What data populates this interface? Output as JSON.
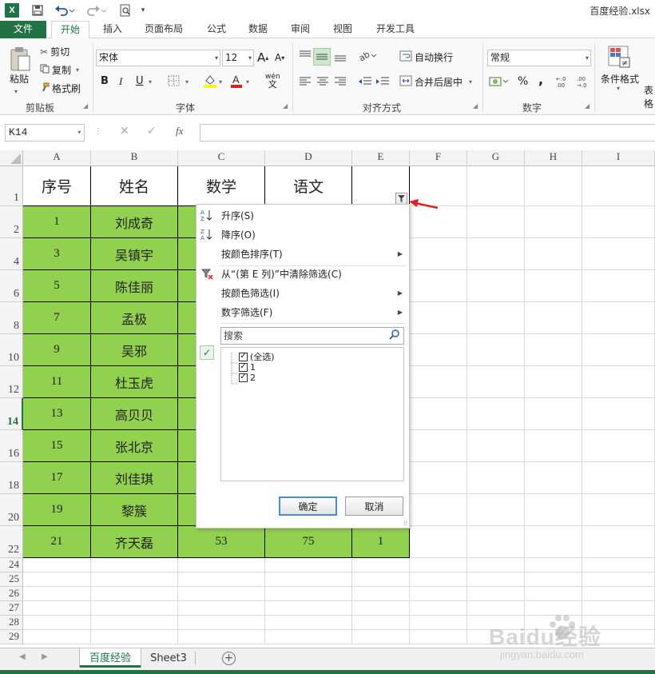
{
  "window": {
    "app_icon": "X",
    "title": "百度经验.xlsx"
  },
  "ribbon_tabs": [
    "文件",
    "开始",
    "插入",
    "页面布局",
    "公式",
    "数据",
    "审阅",
    "视图",
    "开发工具"
  ],
  "ribbon": {
    "clipboard": {
      "paste": "粘贴",
      "cut": "剪切",
      "copy": "复制",
      "format_painter": "格式刷",
      "label": "剪贴板"
    },
    "font": {
      "name": "宋体",
      "size": "12",
      "bold": "B",
      "italic": "I",
      "underline": "U",
      "label": "字体",
      "phonetic": "wén"
    },
    "alignment": {
      "wrap": "自动换行",
      "merge": "合并后居中",
      "label": "对齐方式"
    },
    "number": {
      "format": "常规",
      "percent": "%",
      "comma": ",",
      "label": "数字"
    },
    "styles": {
      "conditional": "条件格式",
      "table_partial": "表格"
    }
  },
  "formula_bar": {
    "name_box": "K14",
    "fx": "fx",
    "value": ""
  },
  "columns": [
    "A",
    "B",
    "C",
    "D",
    "E",
    "F",
    "G",
    "H",
    "I"
  ],
  "header_row": {
    "row": "1",
    "cells": [
      "序号",
      "姓名",
      "数学",
      "语文",
      ""
    ]
  },
  "rows": [
    {
      "row": "2",
      "a": "1",
      "b": "刘成奇"
    },
    {
      "row": "4",
      "a": "3",
      "b": "吴镇宇"
    },
    {
      "row": "6",
      "a": "5",
      "b": "陈佳丽"
    },
    {
      "row": "8",
      "a": "7",
      "b": "孟极"
    },
    {
      "row": "10",
      "a": "9",
      "b": "吴邪"
    },
    {
      "row": "12",
      "a": "11",
      "b": "杜玉虎"
    },
    {
      "row": "14",
      "a": "13",
      "b": "高贝贝"
    },
    {
      "row": "16",
      "a": "15",
      "b": "张北京"
    },
    {
      "row": "18",
      "a": "17",
      "b": "刘佳琪"
    },
    {
      "row": "20",
      "a": "19",
      "b": "黎簇"
    },
    {
      "row": "22",
      "a": "21",
      "b": "齐天磊",
      "c": "53",
      "d": "75",
      "e": "1"
    }
  ],
  "empty_rows": [
    "24",
    "25",
    "26",
    "27",
    "28",
    "29"
  ],
  "filter_menu": {
    "sort_asc": "升序(S)",
    "sort_desc": "降序(O)",
    "sort_by_color": "按颜色排序(T)",
    "clear_filter": "从“(第 E 列)”中清除筛选(C)",
    "filter_by_color": "按颜色筛选(I)",
    "number_filter": "数字筛选(F)",
    "search_placeholder": "搜索",
    "items": [
      "(全选)",
      "1",
      "2"
    ],
    "ok": "确定",
    "cancel": "取消"
  },
  "sheets": [
    "百度经验",
    "Sheet3"
  ],
  "watermark": {
    "brand": "Baidu经验",
    "url": "jingyan.baidu.com"
  },
  "colors": {
    "excel_green": "#217346",
    "cell_green": "#92d050",
    "arrow_red": "#e02020"
  }
}
